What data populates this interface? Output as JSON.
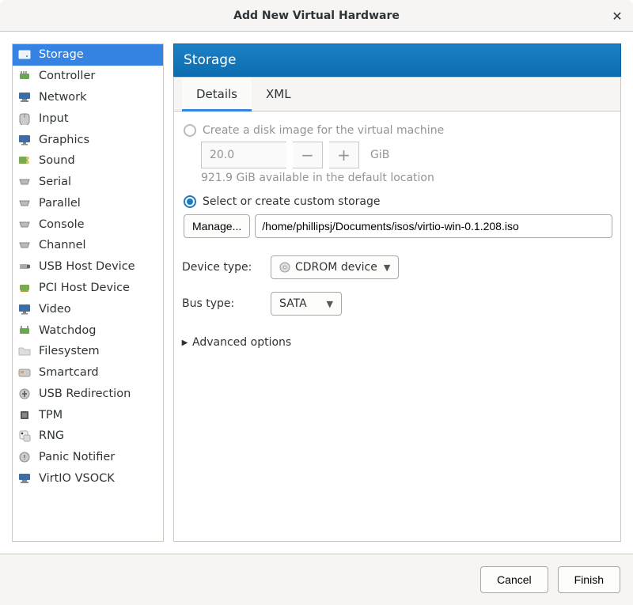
{
  "window": {
    "title": "Add New Virtual Hardware"
  },
  "sidebar": {
    "items": [
      {
        "label": "Storage"
      },
      {
        "label": "Controller"
      },
      {
        "label": "Network"
      },
      {
        "label": "Input"
      },
      {
        "label": "Graphics"
      },
      {
        "label": "Sound"
      },
      {
        "label": "Serial"
      },
      {
        "label": "Parallel"
      },
      {
        "label": "Console"
      },
      {
        "label": "Channel"
      },
      {
        "label": "USB Host Device"
      },
      {
        "label": "PCI Host Device"
      },
      {
        "label": "Video"
      },
      {
        "label": "Watchdog"
      },
      {
        "label": "Filesystem"
      },
      {
        "label": "Smartcard"
      },
      {
        "label": "USB Redirection"
      },
      {
        "label": "TPM"
      },
      {
        "label": "RNG"
      },
      {
        "label": "Panic Notifier"
      },
      {
        "label": "VirtIO VSOCK"
      }
    ],
    "selected_index": 0
  },
  "panel": {
    "title": "Storage"
  },
  "tabs": {
    "items": [
      "Details",
      "XML"
    ],
    "active_index": 0
  },
  "form": {
    "create_image_label": "Create a disk image for the virtual machine",
    "create_image_checked": false,
    "create_image_enabled": false,
    "size_value": "20.0",
    "size_unit": "GiB",
    "available_text": "921.9 GiB available in the default location",
    "custom_storage_label": "Select or create custom storage",
    "custom_storage_checked": true,
    "manage_button": "Manage...",
    "path_value": "/home/phillipsj/Documents/isos/virtio-win-0.1.208.iso",
    "device_type_label": "Device type:",
    "device_type_value": "CDROM device",
    "bus_type_label": "Bus type:",
    "bus_type_value": "SATA",
    "advanced_label": "Advanced options"
  },
  "footer": {
    "cancel": "Cancel",
    "finish": "Finish"
  }
}
